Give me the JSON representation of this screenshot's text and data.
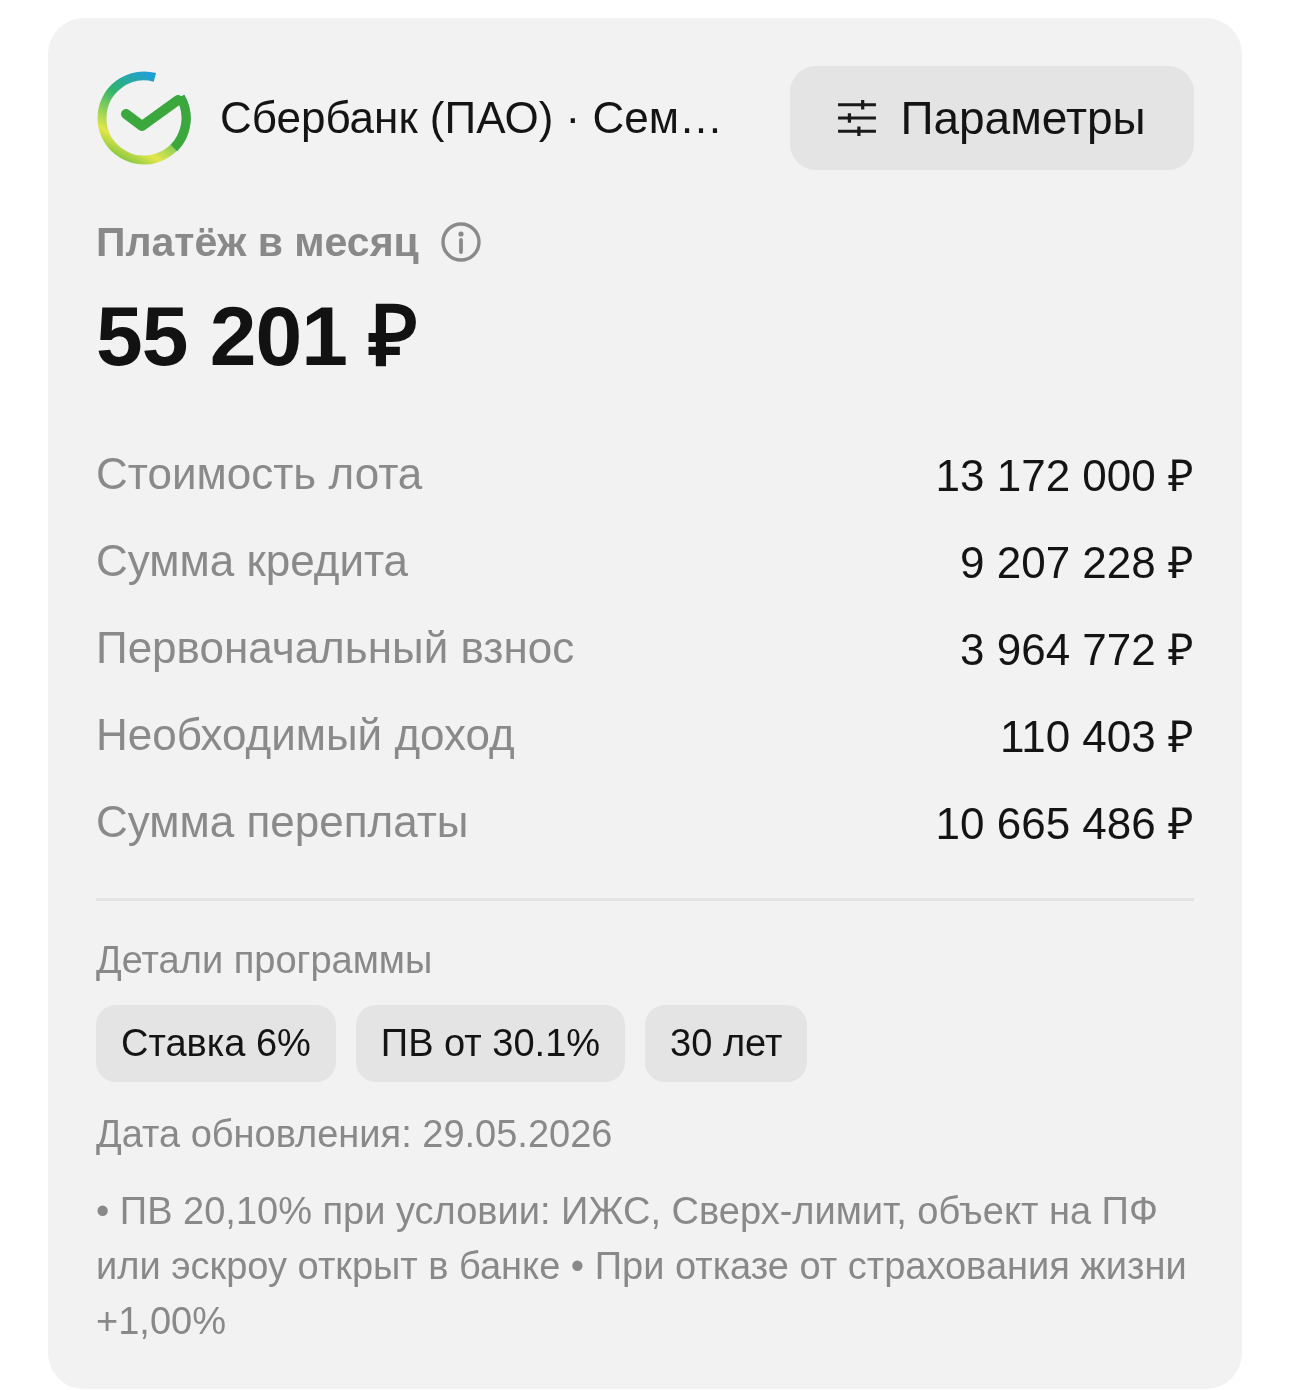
{
  "bank": {
    "name": "Сбербанк (ПАО) · Сем…"
  },
  "params_button": {
    "label": "Параметры"
  },
  "payment": {
    "label": "Платёж в месяц",
    "amount": "55 201 ₽"
  },
  "details": [
    {
      "label": "Стоимость лота",
      "value": "13 172 000 ₽"
    },
    {
      "label": "Сумма кредита",
      "value": "9 207 228 ₽"
    },
    {
      "label": "Первоначальный взнос",
      "value": "3 964 772 ₽"
    },
    {
      "label": "Необходимый доход",
      "value": "110 403 ₽"
    },
    {
      "label": "Сумма переплаты",
      "value": "10 665 486 ₽"
    }
  ],
  "program": {
    "title": "Детали программы",
    "tags": [
      "Ставка 6%",
      "ПВ от 30.1%",
      "30 лет"
    ]
  },
  "updated": "Дата обновления: 29.05.2026",
  "note": "• ПВ 20,10% при условии: ИЖС, Сверх-лимит, объект на ПФ или эскроу открыт в банке • При отказе от страхования жизни +1,00%"
}
